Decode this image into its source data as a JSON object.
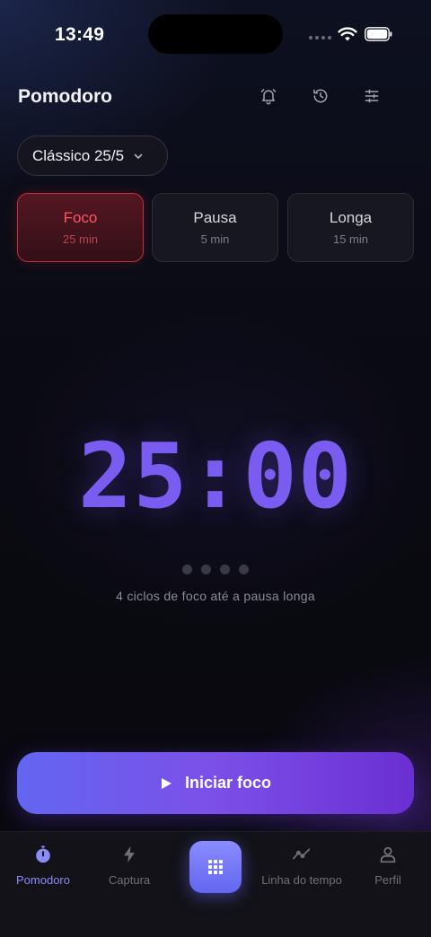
{
  "status_bar": {
    "time": "13:49"
  },
  "header": {
    "title": "Pomodoro",
    "icons": [
      "alarm-icon",
      "history-icon",
      "sliders-icon"
    ]
  },
  "preset": {
    "label": "Clássico 25/5",
    "icon": "chevron-down-icon"
  },
  "modes": [
    {
      "name": "Foco",
      "duration": "25 min",
      "active": true
    },
    {
      "name": "Pausa",
      "duration": "5 min",
      "active": false
    },
    {
      "name": "Longa",
      "duration": "15 min",
      "active": false
    }
  ],
  "timer": {
    "display": "25:00",
    "cycles_total": 4,
    "cycles_done": 0,
    "cycle_text": "4 ciclos de foco até a pausa longa"
  },
  "start_button": {
    "label": "Iniciar foco",
    "icon": "play-icon"
  },
  "tab_bar": {
    "tabs": [
      {
        "label": "Pomodoro",
        "icon": "stopwatch-icon",
        "active": true
      },
      {
        "label": "Captura",
        "icon": "bolt-icon",
        "active": false
      },
      {
        "label": "",
        "icon": "grid-icon",
        "active": false
      },
      {
        "label": "Linha do tempo",
        "icon": "timeline-icon",
        "active": false
      },
      {
        "label": "Perfil",
        "icon": "person-icon",
        "active": false
      }
    ]
  },
  "colors": {
    "accent": "#6366f1",
    "timer": "#7a5cf0",
    "focus_red": "#ff5563",
    "background": "#09090f"
  }
}
